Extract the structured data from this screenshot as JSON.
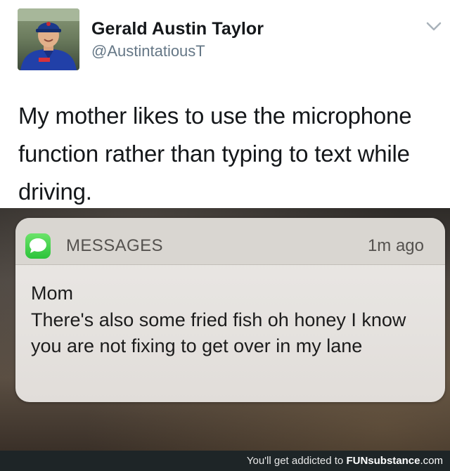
{
  "tweet": {
    "display_name": "Gerald Austin Taylor",
    "handle": "@AustintatiousT",
    "text": "My mother likes to use the microphone function rather than typing to text while driving.",
    "avatar_icon": "profile-photo",
    "menu_icon": "chevron-down-icon"
  },
  "notification": {
    "app_name": "MESSAGES",
    "app_icon": "messages-bubble-icon",
    "app_icon_color": "#34c759",
    "time": "1m ago",
    "sender": "Mom",
    "message": "There's also some fried fish oh honey I know you are not fixing to get over in my lane"
  },
  "footer": {
    "prefix": "You'll get addicted to ",
    "brand": "FUNsubstance",
    "suffix": ".com"
  }
}
